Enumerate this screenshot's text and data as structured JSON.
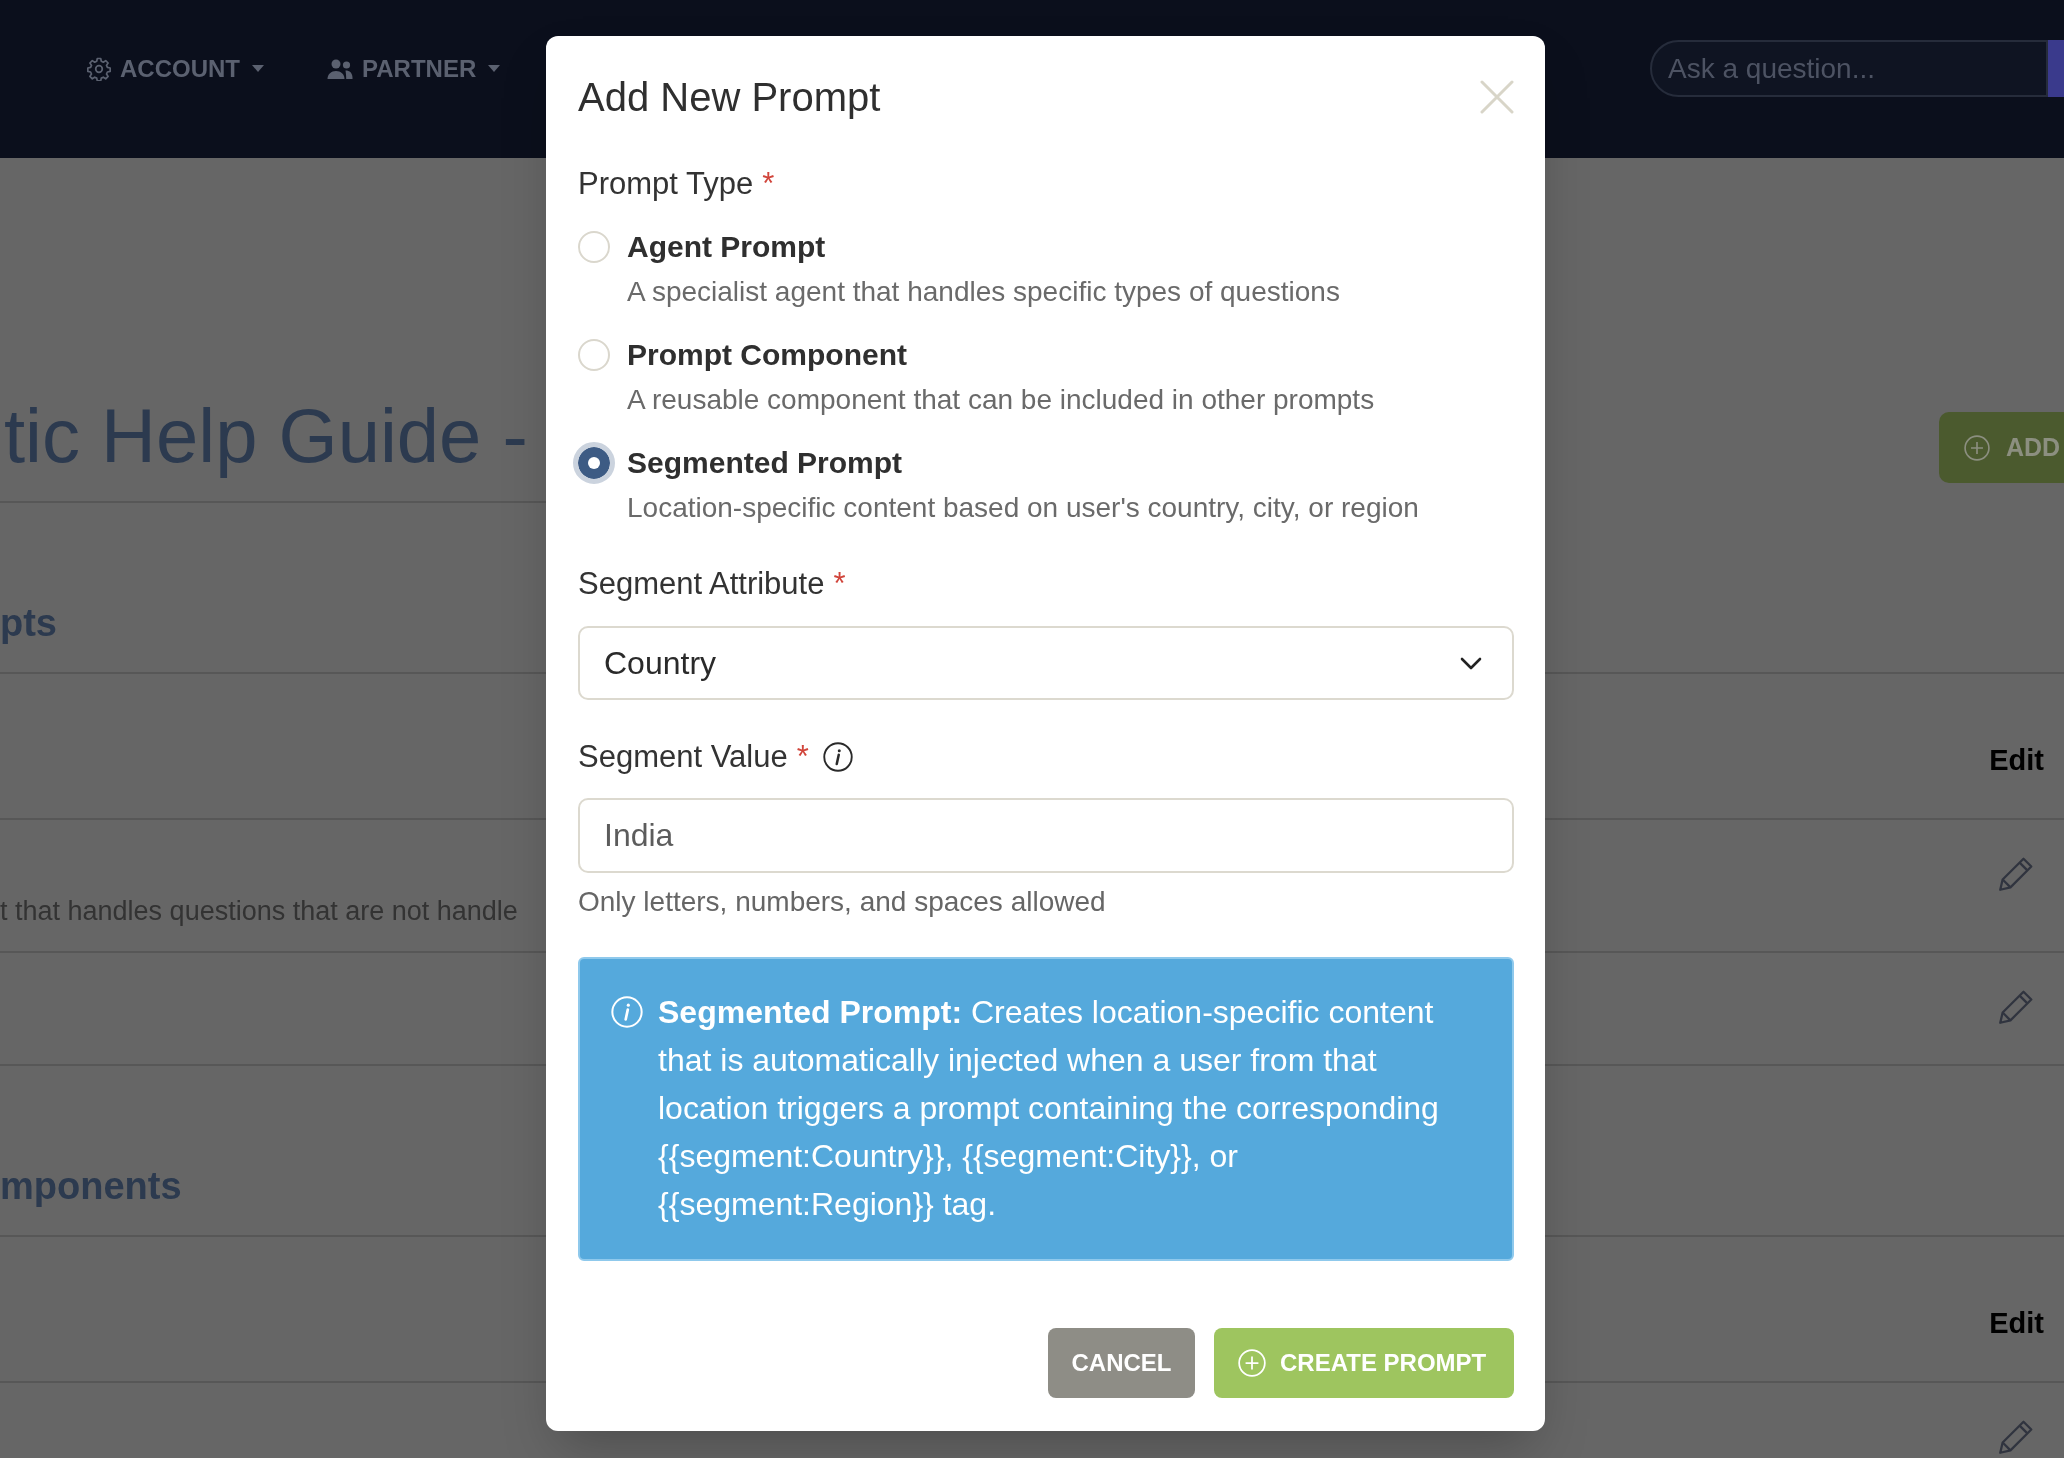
{
  "nav": {
    "menus": [
      {
        "label": "ACCOUNT"
      },
      {
        "label": "PARTNER"
      }
    ],
    "search": {
      "placeholder": "Ask a question..."
    }
  },
  "page": {
    "title": "tic Help Guide -",
    "add_button": "ADD",
    "sections": [
      {
        "heading": "pts",
        "rows": [
          {
            "kind": "header",
            "label": "Edit"
          },
          {
            "kind": "item",
            "description": "t that handles questions that are not handle"
          },
          {
            "kind": "item"
          }
        ]
      },
      {
        "heading": "mponents",
        "rows": [
          {
            "kind": "header",
            "label": "Edit"
          },
          {
            "kind": "item"
          }
        ]
      }
    ]
  },
  "dialog": {
    "title": "Add New Prompt",
    "prompt_type": {
      "label": "Prompt Type",
      "required_mark": "*",
      "options": [
        {
          "title": "Agent Prompt",
          "description": "A specialist agent that handles specific types of questions",
          "selected": false
        },
        {
          "title": "Prompt Component",
          "description": "A reusable component that can be included in other prompts",
          "selected": false
        },
        {
          "title": "Segmented Prompt",
          "description": "Location-specific content based on user's country, city, or region",
          "selected": true
        }
      ]
    },
    "segment_attribute": {
      "label": "Segment Attribute",
      "required_mark": "*",
      "value": "Country"
    },
    "segment_value": {
      "label": "Segment Value",
      "required_mark": "*",
      "placeholder": "India",
      "hint": "Only letters, numbers, and spaces allowed"
    },
    "info_note": "**Segmented Prompt:** Creates location-specific content that is automatically injected when a user from that location triggers a prompt containing the corresponding {{segment:Country}}, {{segment:City}}, or {{segment:Region}} tag.",
    "buttons": [
      {
        "label": "CANCEL",
        "kind": "secondary"
      },
      {
        "label": "CREATE PROMPT",
        "kind": "primary"
      }
    ]
  }
}
